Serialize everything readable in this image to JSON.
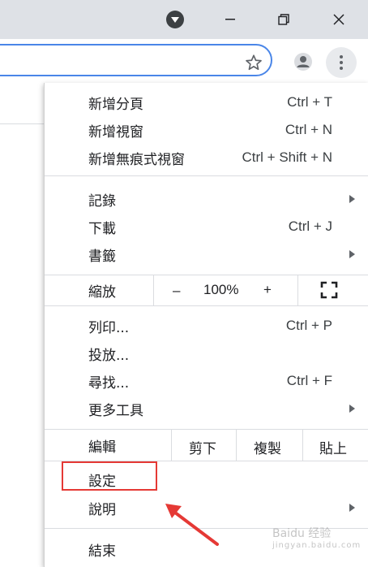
{
  "window": {
    "icons": {
      "dropdown": "dropdown-icon",
      "minimize": "minimize-icon",
      "maximize": "maximize-icon",
      "close": "close-icon"
    }
  },
  "toolbar": {
    "icons": {
      "bookmark": "star-icon",
      "profile": "profile-icon",
      "menu": "kebab-menu-icon"
    }
  },
  "menu": {
    "new_tab": {
      "label": "新增分頁",
      "shortcut": "Ctrl + T"
    },
    "new_window": {
      "label": "新增視窗",
      "shortcut": "Ctrl + N"
    },
    "incognito": {
      "label": "新增無痕式視窗",
      "shortcut": "Ctrl + Shift + N"
    },
    "history": {
      "label": "記錄"
    },
    "downloads": {
      "label": "下載",
      "shortcut": "Ctrl + J"
    },
    "bookmarks": {
      "label": "書籤"
    },
    "zoom": {
      "label": "縮放",
      "minus": "–",
      "value": "100%",
      "plus": "+"
    },
    "print": {
      "label": "列印...",
      "shortcut": "Ctrl + P"
    },
    "cast": {
      "label": "投放..."
    },
    "find": {
      "label": "尋找...",
      "shortcut": "Ctrl + F"
    },
    "more_tools": {
      "label": "更多工具"
    },
    "edit": {
      "label": "編輯",
      "cut": "剪下",
      "copy": "複製",
      "paste": "貼上"
    },
    "settings": {
      "label": "設定"
    },
    "help": {
      "label": "說明"
    },
    "exit": {
      "label": "結束"
    }
  },
  "annotation": {
    "highlight_color": "#e53935"
  },
  "watermark": {
    "text": "Baidu 经验",
    "sub": "jingyan.baidu.com"
  }
}
